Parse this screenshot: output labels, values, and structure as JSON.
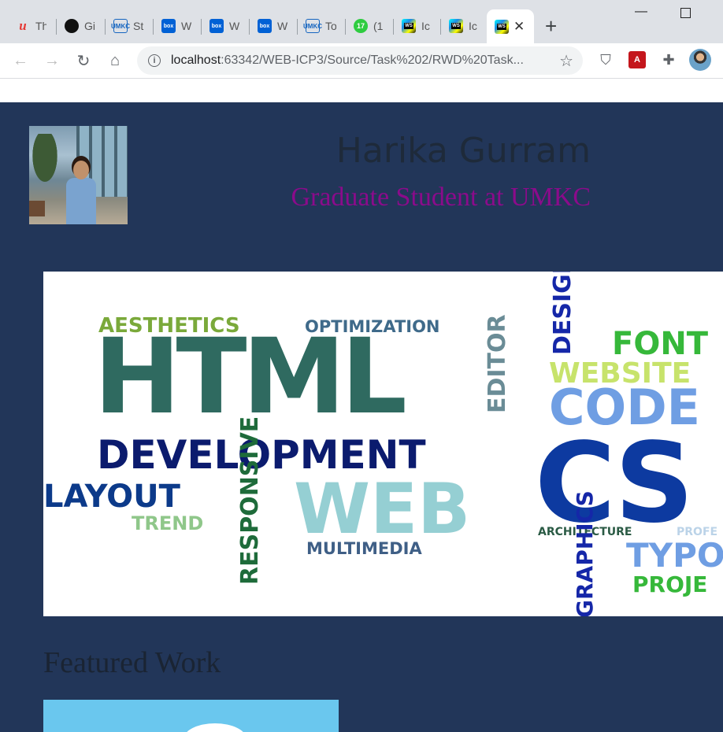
{
  "browser": {
    "tabs": [
      {
        "title": "Th",
        "icon": "udemy-icon"
      },
      {
        "title": "Gi",
        "icon": "github-icon"
      },
      {
        "title": "St",
        "icon": "umkc-icon"
      },
      {
        "title": "W",
        "icon": "box-icon"
      },
      {
        "title": "W",
        "icon": "box-icon"
      },
      {
        "title": "W",
        "icon": "box-icon"
      },
      {
        "title": "To",
        "icon": "umkc-icon"
      },
      {
        "title": "(1",
        "icon": "notification-icon",
        "badge": "17"
      },
      {
        "title": "Ic",
        "icon": "webstorm-icon"
      },
      {
        "title": "Ic",
        "icon": "webstorm-icon"
      },
      {
        "title": "",
        "icon": "webstorm-icon",
        "active": true
      }
    ],
    "fav_labels": {
      "umkc": "UMKC",
      "box": "box",
      "ws": "WS",
      "udemy": "u"
    },
    "url_host": "localhost",
    "url_path": ":63342/WEB-ICP3/Source/Task%202/RWD%20Task...",
    "colors": {
      "tabstrip": "#dee1e6",
      "omnibox": "#f1f3f4"
    }
  },
  "header": {
    "name": "Harika Gurram",
    "subtitle": "Graduate Student at UMKC"
  },
  "banner": {
    "words": [
      "AESTHETICS",
      "OPTIMIZATION",
      "HTML",
      "EDITOR",
      "DESIGNER",
      "FONT",
      "WEBSITE",
      "CODE",
      "DEVELOPMENT",
      "CS",
      "LAYOUT",
      "RESPONSIVE",
      "WEB",
      "TREND",
      "MULTIMEDIA",
      "ARCHITECTURE",
      "PROFE",
      "TYPO",
      "GRAPHICS",
      "PROJE"
    ]
  },
  "featured": {
    "heading": "Featured Work"
  },
  "colors": {
    "page_bg": "#223659",
    "name": "#1e2a3a",
    "subtitle": "#8b0b8b"
  }
}
